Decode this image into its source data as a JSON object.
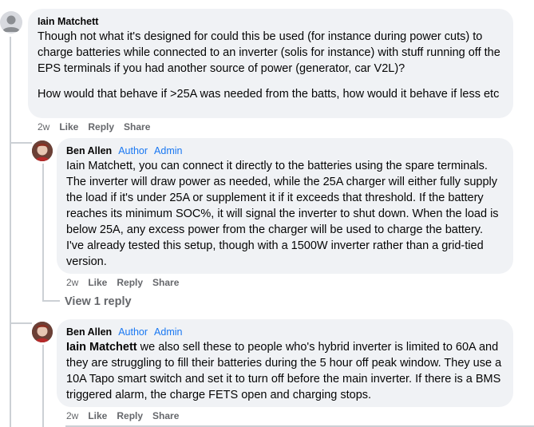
{
  "comments": [
    {
      "author": "Iain Matchett",
      "paragraphs": [
        "Though not what it's designed for could this be used (for instance during power cuts) to charge batteries while connected to an inverter (solis for instance) with stuff running off the EPS terminals if you had another source of power (generator, car V2L)?",
        "How would that behave if >25A was needed from the batts, how would it behave if less etc"
      ],
      "time": "2w",
      "like": "Like",
      "reply": "Reply",
      "share": "Share"
    },
    {
      "author": "Ben Allen",
      "badge_author": "Author",
      "badge_admin": "Admin",
      "text": "Iain Matchett, you can connect it directly to the batteries using the spare terminals. The inverter will draw power as needed, while the 25A charger will either fully supply the load if it's under 25A or supplement it if it exceeds that threshold. If the battery reaches its minimum SOC%, it will signal the inverter to shut down. When the load is below 25A, any excess power from the charger will be used to charge the battery. I've already tested this setup, though with a 1500W inverter rather than a grid-tied version.",
      "time": "2w",
      "like": "Like",
      "reply": "Reply",
      "share": "Share",
      "view_replies": "View 1 reply"
    },
    {
      "author": "Ben Allen",
      "badge_author": "Author",
      "badge_admin": "Admin",
      "mention": "Iain Matchett",
      "text": " we also sell these to people who's hybrid inverter is limited to 60A and they are struggling to fill their batteries during the 5 hour off peak window. They use a 10A Tapo smart switch and set it to turn off before the main inverter. If there is a BMS triggered alarm, the charge FETS open and charging stops.",
      "time": "2w",
      "like": "Like",
      "reply": "Reply",
      "share": "Share"
    }
  ]
}
